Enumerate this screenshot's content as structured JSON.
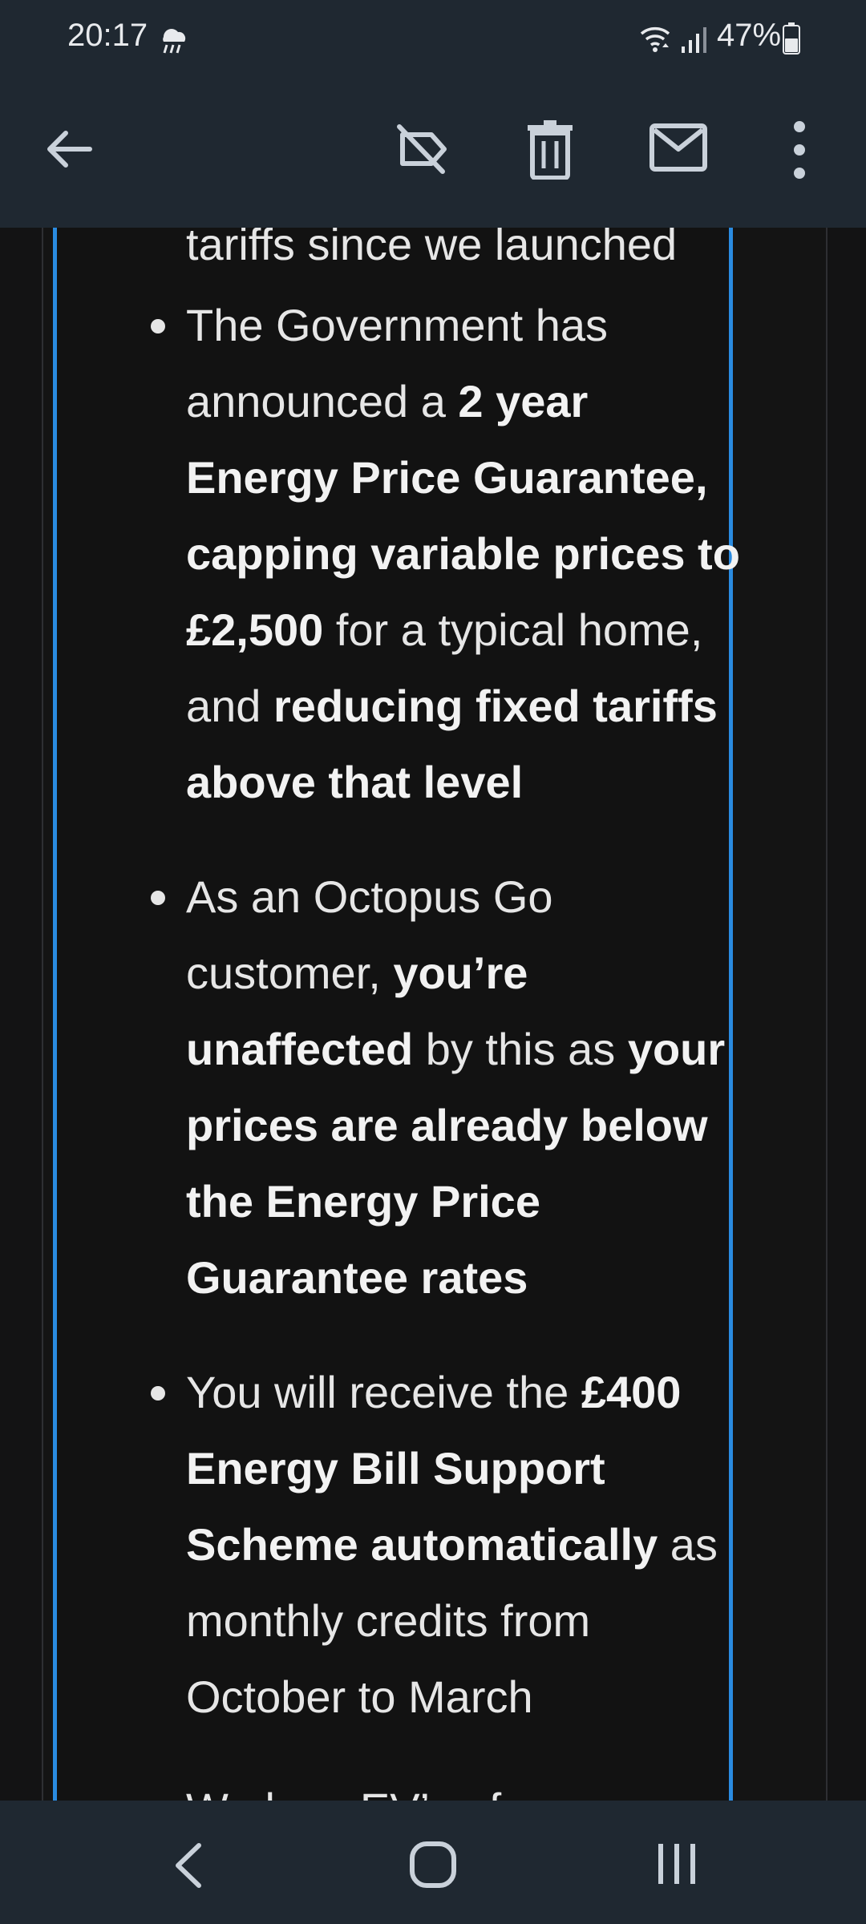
{
  "status_bar": {
    "time": "20:17",
    "battery_percent": "47%",
    "icons": [
      "rain-weather-icon",
      "wifi-icon",
      "cell-signal-icon",
      "battery-icon"
    ]
  },
  "app_bar": {
    "icons": [
      "back-arrow-icon",
      "label-off-icon",
      "trash-icon",
      "mail-icon",
      "more-vert-icon"
    ]
  },
  "email": {
    "partial_top_line": "tariffs since we launched",
    "bullets": [
      {
        "segments": [
          {
            "text": "The Government has announced a ",
            "bold": false
          },
          {
            "text": "2 year Energy Price Guarantee, capping variable prices to £2,500",
            "bold": true
          },
          {
            "text": " for a typical home, and ",
            "bold": false
          },
          {
            "text": "reducing fixed tariffs above that level",
            "bold": true
          }
        ]
      },
      {
        "segments": [
          {
            "text": "As an Octopus Go customer, ",
            "bold": false
          },
          {
            "text": "you’re unaffected",
            "bold": true
          },
          {
            "text": " by this as ",
            "bold": false
          },
          {
            "text": "your prices are already below the Energy Price Guarantee rates",
            "bold": true
          }
        ]
      },
      {
        "segments": [
          {
            "text": "You will receive the ",
            "bold": false
          },
          {
            "text": "£400 Energy Bill Support Scheme automatically",
            "bold": true
          },
          {
            "text": " as monthly credits from October to March",
            "bold": false
          }
        ]
      }
    ],
    "partial_bottom_line": "We love EV’s of"
  },
  "colors": {
    "chrome": "#1f2831",
    "background": "#131314",
    "accent_border": "#2a8be0",
    "text": "#e6e6e6"
  },
  "nav_bar": {
    "icons": [
      "nav-back-icon",
      "nav-home-icon",
      "nav-recents-icon"
    ]
  }
}
